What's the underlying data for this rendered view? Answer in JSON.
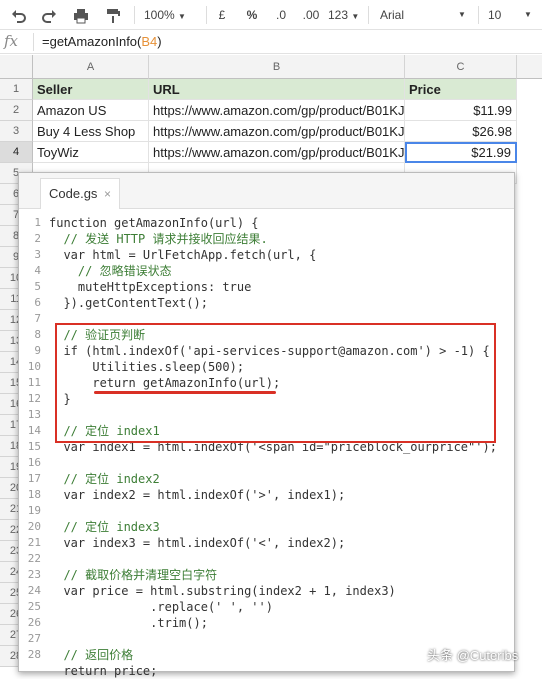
{
  "toolbar": {
    "zoom": "100%",
    "currency": "£",
    "percent": "%",
    "decimal_dec": ".0",
    "decimal_inc": ".00",
    "more_formats": "123",
    "font": "Arial",
    "font_size": "10"
  },
  "formula_bar": {
    "fx": "fx",
    "formula_prefix": "=getAmazonInfo(",
    "formula_ref": "B4",
    "formula_suffix": ")"
  },
  "columns": [
    "A",
    "B",
    "C"
  ],
  "rows": [
    "1",
    "2",
    "3",
    "4",
    "5",
    "6",
    "7",
    "8",
    "9",
    "10",
    "11",
    "12",
    "13",
    "14",
    "15",
    "16",
    "17",
    "18",
    "19",
    "20",
    "21",
    "22",
    "23",
    "24",
    "25",
    "26",
    "27",
    "28"
  ],
  "table": {
    "headers": [
      "Seller",
      "URL",
      "Price"
    ],
    "data": [
      [
        "Amazon US",
        "https://www.amazon.com/gp/product/B01KJ",
        "$11.99"
      ],
      [
        "Buy 4 Less Shop",
        "https://www.amazon.com/gp/product/B01KJ",
        "$26.98"
      ],
      [
        "ToyWiz",
        "https://www.amazon.com/gp/product/B01KJ",
        "$21.99"
      ]
    ]
  },
  "editor": {
    "tab_name": "Code.gs",
    "tab_close": "×",
    "line_numbers": [
      "1",
      "2",
      "3",
      "4",
      "5",
      "6",
      "7",
      "8",
      "9",
      "10",
      "11",
      "12",
      "13",
      "14",
      "15",
      "16",
      "17",
      "18",
      "19",
      "20",
      "21",
      "22",
      "23",
      "24",
      "25",
      "26",
      "27",
      "28"
    ],
    "code": [
      "function getAmazonInfo(url) {",
      "  // 发送 HTTP 请求并接收回应结果.",
      "  var html = UrlFetchApp.fetch(url, {",
      "    // 忽略错误状态",
      "    muteHttpExceptions: true",
      "  }).getContentText();",
      "",
      "  // 验证页判断",
      "  if (html.indexOf('api-services-support@amazon.com') > -1) {",
      "      Utilities.sleep(500);",
      "      return getAmazonInfo(url);",
      "  }",
      "",
      "  // 定位 index1",
      "  var index1 = html.indexOf('<span id=\"priceblock_ourprice\"');",
      "",
      "  // 定位 index2",
      "  var index2 = html.indexOf('>', index1);",
      "",
      "  // 定位 index3",
      "  var index3 = html.indexOf('<', index2);",
      "",
      "  // 截取价格并清理空白字符",
      "  var price = html.substring(index2 + 1, index3)",
      "              .replace(' ', '')",
      "              .trim();",
      "",
      "  // 返回价格",
      "  return price;"
    ]
  },
  "watermark": "头条 @Cuteribs",
  "colors": {
    "header_fill": "#d9ead3",
    "selection_border": "#4a86e8",
    "highlight_box": "#d93025",
    "comment": "#3d7e36",
    "keyword": "#1f3fbf"
  }
}
